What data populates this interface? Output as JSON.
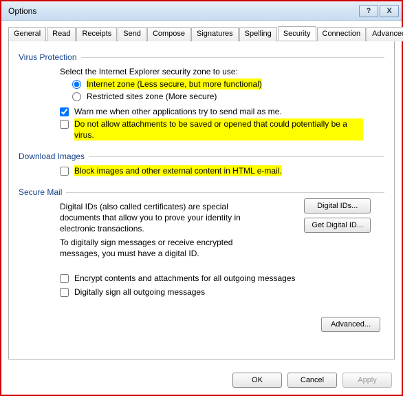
{
  "window": {
    "title": "Options",
    "help": "?",
    "close": "X"
  },
  "tabs": [
    "General",
    "Read",
    "Receipts",
    "Send",
    "Compose",
    "Signatures",
    "Spelling",
    "Security",
    "Connection",
    "Advanced"
  ],
  "active_tab": "Security",
  "virus": {
    "heading": "Virus Protection",
    "zone_label": "Select the Internet Explorer security zone to use:",
    "internet_zone": "Internet zone (Less secure, but more functional)",
    "restricted_zone": "Restricted sites zone (More secure)",
    "warn": "Warn me when other applications try to send mail as me.",
    "no_attach": "Do not allow attachments to be saved or opened that could potentially be a virus."
  },
  "download": {
    "heading": "Download Images",
    "block": "Block images and other external content in HTML e-mail."
  },
  "secure": {
    "heading": "Secure Mail",
    "desc1": "Digital IDs (also called certificates) are special documents that allow you to prove your identity in electronic transactions.",
    "desc2": "To digitally sign messages or receive encrypted messages, you must have a digital ID.",
    "digital_ids_btn": "Digital IDs...",
    "get_digital_id_btn": "Get Digital ID...",
    "encrypt": "Encrypt contents and attachments for all outgoing messages",
    "sign": "Digitally sign all outgoing messages",
    "advanced_btn": "Advanced..."
  },
  "buttons": {
    "ok": "OK",
    "cancel": "Cancel",
    "apply": "Apply"
  }
}
